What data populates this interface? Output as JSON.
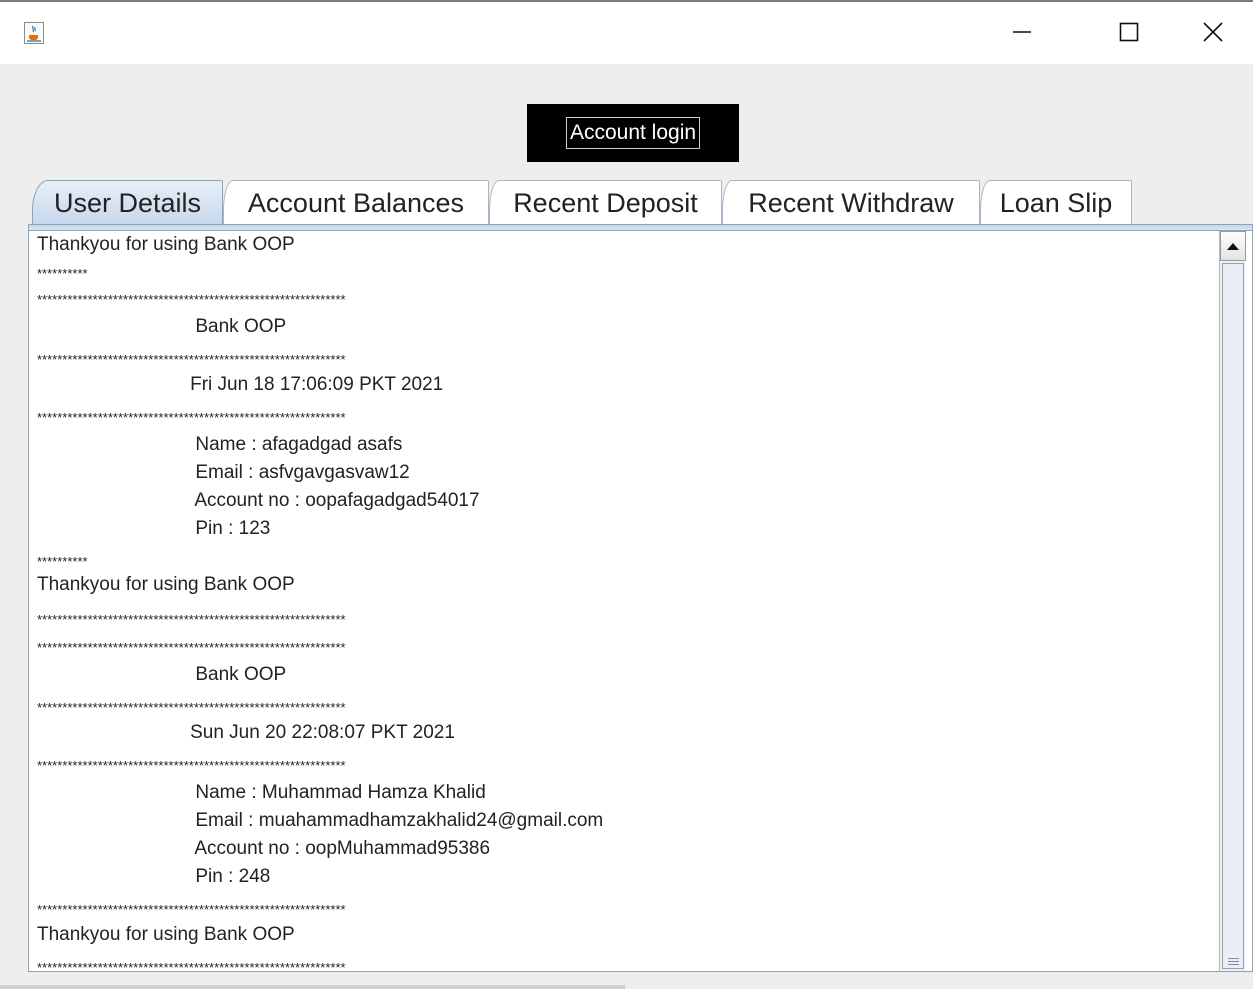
{
  "window": {
    "icon": "java-cup-icon",
    "controls": {
      "minimize": "minimize-icon",
      "maximize": "maximize-icon",
      "close": "close-icon"
    }
  },
  "header": {
    "login_label": "Account login"
  },
  "tabs": [
    {
      "label": "User Details",
      "active": true
    },
    {
      "label": "Account Balances",
      "active": false
    },
    {
      "label": "Recent Deposit",
      "active": false
    },
    {
      "label": "Recent Withdraw",
      "active": false
    },
    {
      "label": "Loan Slip",
      "active": false
    }
  ],
  "content": {
    "lines": [
      "Thankyou for using Bank OOP",
      "**********",
      "*************************************************************",
      "                              Bank OOP",
      "*************************************************************",
      "                             Fri Jun 18 17:06:09 PKT 2021",
      "*************************************************************",
      "                              Name : afagadgad asafs",
      "                              Email : asfvgavgasvaw12",
      "                              Account no : oopafagadgad54017",
      "                              Pin : 123",
      "**********",
      "Thankyou for using Bank OOP",
      "*************************************************************",
      "*************************************************************",
      "                              Bank OOP",
      "*************************************************************",
      "                             Sun Jun 20 22:08:07 PKT 2021",
      "*************************************************************",
      "                              Name : Muhammad Hamza Khalid",
      "                              Email : muahammadhamzakhalid24@gmail.com",
      "                              Account no : oopMuhammad95386",
      "                              Pin : 248",
      "*************************************************************",
      "Thankyou for using Bank OOP",
      "*************************************************************"
    ]
  },
  "colors": {
    "accent": "#c5d6ec",
    "login_bg": "#000000",
    "login_text": "#ffffff"
  }
}
